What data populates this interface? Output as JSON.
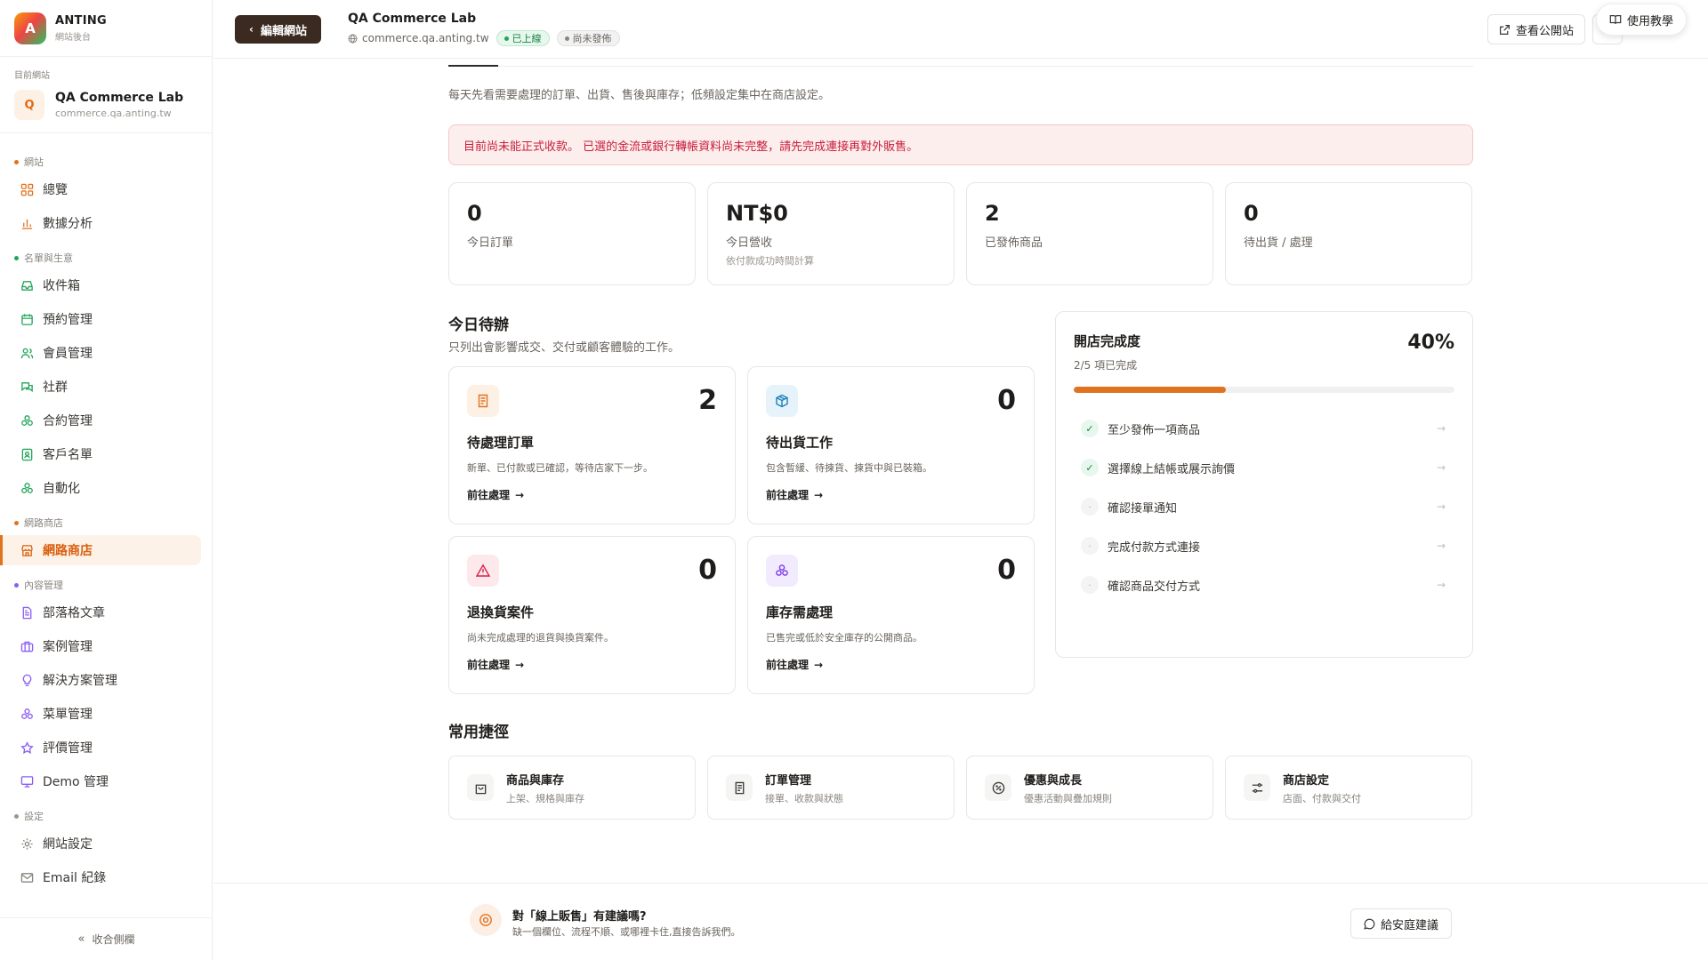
{
  "brand": {
    "logo_letter": "A",
    "name": "ANTING",
    "sub": "網站後台"
  },
  "site": {
    "caption": "目前網站",
    "avatar_letter": "Q",
    "name": "QA Commerce Lab",
    "domain": "commerce.qa.anting.tw"
  },
  "sidebar": {
    "sections": [
      {
        "label": "網站",
        "color": "#e0731f"
      },
      {
        "label": "名單與生意",
        "color": "#22a55a"
      },
      {
        "label": "網路商店",
        "color": "#e0731f"
      },
      {
        "label": "內容管理",
        "color": "#8b5cf6"
      },
      {
        "label": "設定",
        "color": "#9a958f"
      }
    ],
    "items": [
      {
        "label": "總覽",
        "icon": "grid-icon",
        "color": "#e0731f"
      },
      {
        "label": "數據分析",
        "icon": "bar-chart-icon",
        "color": "#e0731f"
      },
      {
        "label": "收件箱",
        "icon": "inbox-icon",
        "color": "#22a55a"
      },
      {
        "label": "預約管理",
        "icon": "calendar-icon",
        "color": "#22a55a"
      },
      {
        "label": "會員管理",
        "icon": "users-icon",
        "color": "#22a55a"
      },
      {
        "label": "社群",
        "icon": "chat-icon",
        "color": "#22a55a"
      },
      {
        "label": "合約管理",
        "icon": "cluster-icon",
        "color": "#22a55a"
      },
      {
        "label": "客戶名單",
        "icon": "contact-icon",
        "color": "#22a55a"
      },
      {
        "label": "自動化",
        "icon": "cluster-icon",
        "color": "#22a55a"
      },
      {
        "label": "網路商店",
        "icon": "store-icon",
        "color": "#e0731f"
      },
      {
        "label": "部落格文章",
        "icon": "doc-icon",
        "color": "#8b5cf6"
      },
      {
        "label": "案例管理",
        "icon": "briefcase-icon",
        "color": "#8b5cf6"
      },
      {
        "label": "解決方案管理",
        "icon": "bulb-icon",
        "color": "#8b5cf6"
      },
      {
        "label": "菜單管理",
        "icon": "cluster-icon",
        "color": "#8b5cf6"
      },
      {
        "label": "評價管理",
        "icon": "star-icon",
        "color": "#8b5cf6"
      },
      {
        "label": "Demo 管理",
        "icon": "monitor-icon",
        "color": "#8b5cf6"
      },
      {
        "label": "網站設定",
        "icon": "gear-icon",
        "color": "#9a958f"
      },
      {
        "label": "Email 紀錄",
        "icon": "mail-icon",
        "color": "#9a958f"
      }
    ],
    "collapse_label": "收合側欄"
  },
  "topbar": {
    "edit_label": "編輯網站",
    "title": "QA Commerce Lab",
    "domain": "commerce.qa.anting.tw",
    "badge_live": "已上線",
    "badge_unpub": "尚未發佈",
    "view_label": "查看公開站",
    "tutorial_label": "使用教學"
  },
  "main": {
    "intro": "每天先看需要處理的訂單、出貨、售後與庫存；低頻設定集中在商店設定。",
    "alert": "目前尚未能正式收款。 已選的金流或銀行轉帳資料尚未完整，請先完成連接再對外販售。",
    "stats": [
      {
        "value": "0",
        "label": "今日訂單",
        "note": ""
      },
      {
        "value": "NT$0",
        "label": "今日營收",
        "note": "依付款成功時間計算"
      },
      {
        "value": "2",
        "label": "已發佈商品",
        "note": ""
      },
      {
        "value": "0",
        "label": "待出貨 / 處理",
        "note": ""
      }
    ],
    "todo_title": "今日待辦",
    "todo_sub": "只列出會影響成交、交付或顧客體驗的工作。",
    "tasks": [
      {
        "count": "2",
        "title": "待處理訂單",
        "desc": "新單、已付款或已確認，等待店家下一步。",
        "link": "前往處理",
        "icon": "receipt-icon",
        "bg": "#fdf0e4",
        "fg": "#e0731f"
      },
      {
        "count": "0",
        "title": "待出貨工作",
        "desc": "包含暫緩、待揀貨、揀貨中與已裝箱。",
        "link": "前往處理",
        "icon": "box-icon",
        "bg": "#e6f3fb",
        "fg": "#1f7fb8"
      },
      {
        "count": "0",
        "title": "退換貨案件",
        "desc": "尚未完成處理的退貨與換貨案件。",
        "link": "前往處理",
        "icon": "warning-icon",
        "bg": "#fde9ec",
        "fg": "#d61f45"
      },
      {
        "count": "0",
        "title": "庫存需處理",
        "desc": "已售完或低於安全庫存的公開商品。",
        "link": "前往處理",
        "icon": "cluster-icon",
        "bg": "#f1ebfd",
        "fg": "#7c3aed"
      }
    ],
    "progress": {
      "title": "開店完成度",
      "sub": "2/5 項已完成",
      "percent_label": "40%",
      "fraction": 0.4,
      "items": [
        {
          "label": "至少發佈一項商品",
          "done": true
        },
        {
          "label": "選擇線上結帳或展示詢價",
          "done": true
        },
        {
          "label": "確認接單通知",
          "done": false
        },
        {
          "label": "完成付款方式連接",
          "done": false
        },
        {
          "label": "確認商品交付方式",
          "done": false
        }
      ]
    },
    "shortcuts_title": "常用捷徑",
    "shortcuts": [
      {
        "title": "商品與庫存",
        "desc": "上架、規格與庫存",
        "icon": "bag-icon"
      },
      {
        "title": "訂單管理",
        "desc": "接單、收款與狀態",
        "icon": "receipt-icon"
      },
      {
        "title": "優惠與成長",
        "desc": "優惠活動與疊加規則",
        "icon": "percent-icon"
      },
      {
        "title": "商店設定",
        "desc": "店面、付款與交付",
        "icon": "sliders-icon"
      }
    ]
  },
  "feedback": {
    "title": "對「線上販售」有建議嗎?",
    "desc": "缺一個欄位、流程不順、或哪裡卡住,直接告訴我們。",
    "button": "給安庭建議"
  }
}
